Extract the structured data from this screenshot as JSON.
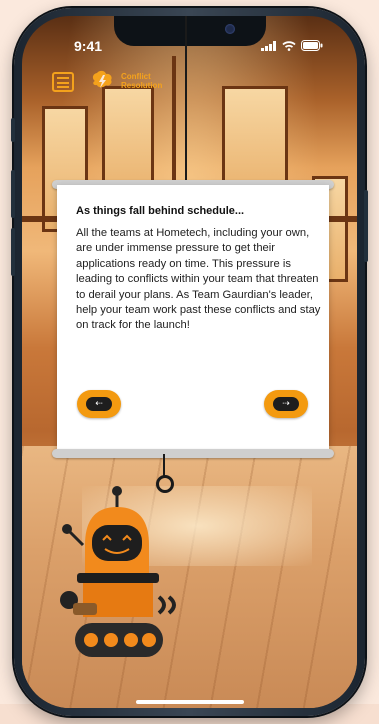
{
  "status_bar": {
    "time": "9:41"
  },
  "app": {
    "logo_line1": "Conflict",
    "logo_line2": "Resolution"
  },
  "dialog": {
    "title": "As things fall behind schedule...",
    "body": "All the teams at Hometech, including your own, are under immense pressure to get their applications ready on time. This pressure is leading to conflicts within your team that threaten to derail your plans. As Team Gaurdian's leader, help your team work past these conflicts and stay on track for the launch!"
  },
  "colors": {
    "accent": "#f39a10",
    "card": "#ffffff",
    "frame": "#1b2530"
  },
  "icons": {
    "menu": "menu-icon",
    "logo": "lightning-logo-icon",
    "prev": "arrow-left-icon",
    "next": "arrow-right-icon"
  }
}
